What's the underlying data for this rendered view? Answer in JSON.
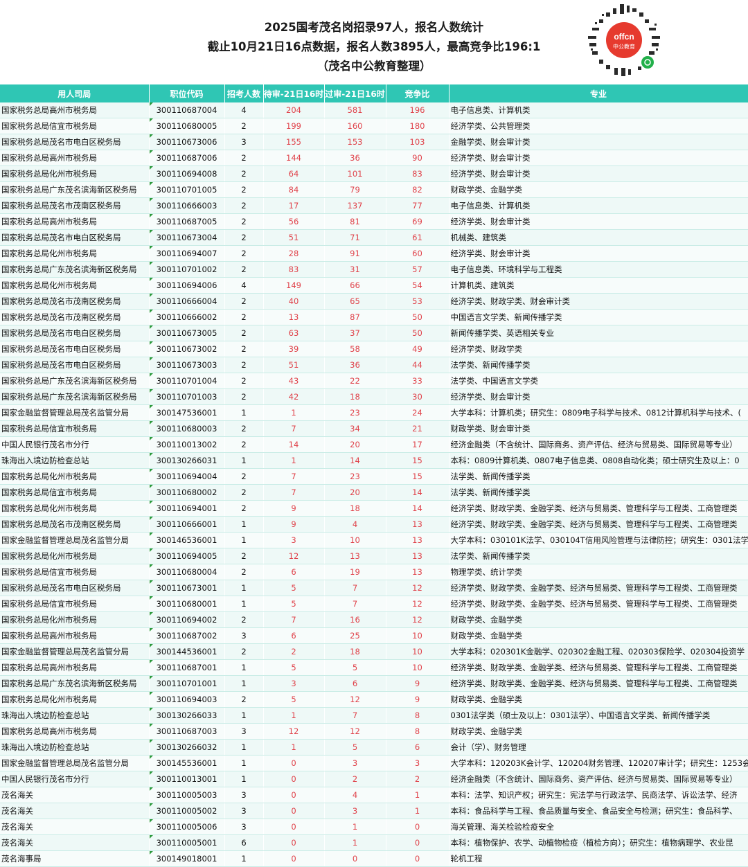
{
  "title": {
    "line1": "2025国考茂名岗招录97人，报名人数统计",
    "line2": "截止10月21日16点数据，报名人数3895人，最高竞争比196:1",
    "line3": "（茂名中公教育整理）"
  },
  "logo": {
    "text1": "offcn",
    "text2": "中公教育"
  },
  "columns": [
    "用人司局",
    "职位代码",
    "招考人数",
    "待审-21日16时",
    "过审-21日16时",
    "竞争比",
    "专业"
  ],
  "rows": [
    [
      "国家税务总局高州市税务局",
      "300110687004",
      "4",
      "204",
      "581",
      "196",
      "电子信息类、计算机类"
    ],
    [
      "国家税务总局信宜市税务局",
      "300110680005",
      "2",
      "199",
      "160",
      "180",
      "经济学类、公共管理类"
    ],
    [
      "国家税务总局茂名市电白区税务局",
      "300110673006",
      "3",
      "155",
      "153",
      "103",
      "金融学类、财会审计类"
    ],
    [
      "国家税务总局高州市税务局",
      "300110687006",
      "2",
      "144",
      "36",
      "90",
      "经济学类、财会审计类"
    ],
    [
      "国家税务总局化州市税务局",
      "300110694008",
      "2",
      "64",
      "101",
      "83",
      "经济学类、财会审计类"
    ],
    [
      "国家税务总局广东茂名滨海新区税务局",
      "300110701005",
      "2",
      "84",
      "79",
      "82",
      "财政学类、金融学类"
    ],
    [
      "国家税务总局茂名市茂南区税务局",
      "300110666003",
      "2",
      "17",
      "137",
      "77",
      "电子信息类、计算机类"
    ],
    [
      "国家税务总局高州市税务局",
      "300110687005",
      "2",
      "56",
      "81",
      "69",
      "经济学类、财会审计类"
    ],
    [
      "国家税务总局茂名市电白区税务局",
      "300110673004",
      "2",
      "51",
      "71",
      "61",
      "机械类、建筑类"
    ],
    [
      "国家税务总局化州市税务局",
      "300110694007",
      "2",
      "28",
      "91",
      "60",
      "经济学类、财会审计类"
    ],
    [
      "国家税务总局广东茂名滨海新区税务局",
      "300110701002",
      "2",
      "83",
      "31",
      "57",
      "电子信息类、环境科学与工程类"
    ],
    [
      "国家税务总局化州市税务局",
      "300110694006",
      "4",
      "149",
      "66",
      "54",
      "计算机类、建筑类"
    ],
    [
      "国家税务总局茂名市茂南区税务局",
      "300110666004",
      "2",
      "40",
      "65",
      "53",
      "经济学类、财政学类、财会审计类"
    ],
    [
      "国家税务总局茂名市茂南区税务局",
      "300110666002",
      "2",
      "13",
      "87",
      "50",
      "中国语言文学类、新闻传播学类"
    ],
    [
      "国家税务总局茂名市电白区税务局",
      "300110673005",
      "2",
      "63",
      "37",
      "50",
      "新闻传播学类、英语相关专业"
    ],
    [
      "国家税务总局茂名市电白区税务局",
      "300110673002",
      "2",
      "39",
      "58",
      "49",
      "经济学类、财政学类"
    ],
    [
      "国家税务总局茂名市电白区税务局",
      "300110673003",
      "2",
      "51",
      "36",
      "44",
      "法学类、新闻传播学类"
    ],
    [
      "国家税务总局广东茂名滨海新区税务局",
      "300110701004",
      "2",
      "43",
      "22",
      "33",
      "法学类、中国语言文学类"
    ],
    [
      "国家税务总局广东茂名滨海新区税务局",
      "300110701003",
      "2",
      "42",
      "18",
      "30",
      "经济学类、财会审计类"
    ],
    [
      "国家金融监督管理总局茂名监管分局",
      "300147536001",
      "1",
      "1",
      "23",
      "24",
      "大学本科：计算机类；研究生：0809电子科学与技术、0812计算机科学与技术、("
    ],
    [
      "国家税务总局信宜市税务局",
      "300110680003",
      "2",
      "7",
      "34",
      "21",
      "财政学类、财会审计类"
    ],
    [
      "中国人民银行茂名市分行",
      "300110013002",
      "2",
      "14",
      "20",
      "17",
      "经济金融类（不含统计、国际商务、资产评估、经济与贸易类、国际贸易等专业）"
    ],
    [
      "珠海出入境边防检查总站",
      "300130266031",
      "1",
      "1",
      "14",
      "15",
      "本科：0809计算机类、0807电子信息类、0808自动化类；硕士研究生及以上：0"
    ],
    [
      "国家税务总局化州市税务局",
      "300110694004",
      "2",
      "7",
      "23",
      "15",
      "法学类、新闻传播学类"
    ],
    [
      "国家税务总局信宜市税务局",
      "300110680002",
      "2",
      "7",
      "20",
      "14",
      "法学类、新闻传播学类"
    ],
    [
      "国家税务总局化州市税务局",
      "300110694001",
      "2",
      "9",
      "18",
      "14",
      "经济学类、财政学类、金融学类、经济与贸易类、管理科学与工程类、工商管理类"
    ],
    [
      "国家税务总局茂名市茂南区税务局",
      "300110666001",
      "1",
      "9",
      "4",
      "13",
      "经济学类、财政学类、金融学类、经济与贸易类、管理科学与工程类、工商管理类"
    ],
    [
      "国家金融监督管理总局茂名监管分局",
      "300146536001",
      "1",
      "3",
      "10",
      "13",
      "大学本科：030101K法学、030104T信用风险管理与法律防控；研究生：0301法学"
    ],
    [
      "国家税务总局化州市税务局",
      "300110694005",
      "2",
      "12",
      "13",
      "13",
      "法学类、新闻传播学类"
    ],
    [
      "国家税务总局信宜市税务局",
      "300110680004",
      "2",
      "6",
      "19",
      "13",
      "物理学类、统计学类"
    ],
    [
      "国家税务总局茂名市电白区税务局",
      "300110673001",
      "1",
      "5",
      "7",
      "12",
      "经济学类、财政学类、金融学类、经济与贸易类、管理科学与工程类、工商管理类"
    ],
    [
      "国家税务总局信宜市税务局",
      "300110680001",
      "1",
      "5",
      "7",
      "12",
      "经济学类、财政学类、金融学类、经济与贸易类、管理科学与工程类、工商管理类"
    ],
    [
      "国家税务总局化州市税务局",
      "300110694002",
      "2",
      "7",
      "16",
      "12",
      "财政学类、金融学类"
    ],
    [
      "国家税务总局高州市税务局",
      "300110687002",
      "3",
      "6",
      "25",
      "10",
      "财政学类、金融学类"
    ],
    [
      "国家金融监督管理总局茂名监管分局",
      "300144536001",
      "2",
      "2",
      "18",
      "10",
      "大学本科：020301K金融学、020302金融工程、020303保险学、020304投资学"
    ],
    [
      "国家税务总局高州市税务局",
      "300110687001",
      "1",
      "5",
      "5",
      "10",
      "经济学类、财政学类、金融学类、经济与贸易类、管理科学与工程类、工商管理类"
    ],
    [
      "国家税务总局广东茂名滨海新区税务局",
      "300110701001",
      "1",
      "3",
      "6",
      "9",
      "经济学类、财政学类、金融学类、经济与贸易类、管理科学与工程类、工商管理类"
    ],
    [
      "国家税务总局化州市税务局",
      "300110694003",
      "2",
      "5",
      "12",
      "9",
      "财政学类、金融学类"
    ],
    [
      "珠海出入境边防检查总站",
      "300130266033",
      "1",
      "1",
      "7",
      "8",
      "0301法学类（硕士及以上：0301法学）、中国语言文学类、新闻传播学类"
    ],
    [
      "国家税务总局高州市税务局",
      "300110687003",
      "3",
      "12",
      "12",
      "8",
      "财政学类、金融学类"
    ],
    [
      "珠海出入境边防检查总站",
      "300130266032",
      "1",
      "1",
      "5",
      "6",
      "会计（学）、财务管理"
    ],
    [
      "国家金融监督管理总局茂名监管分局",
      "300145536001",
      "1",
      "0",
      "3",
      "3",
      "大学本科：120203K会计学、120204财务管理、120207审计学；研究生：1253会"
    ],
    [
      "中国人民银行茂名市分行",
      "300110013001",
      "1",
      "0",
      "2",
      "2",
      "经济金融类（不含统计、国际商务、资产评估、经济与贸易类、国际贸易等专业）"
    ],
    [
      "茂名海关",
      "300110005003",
      "3",
      "0",
      "4",
      "1",
      "本科：法学、知识产权；研究生：宪法学与行政法学、民商法学、诉讼法学、经济"
    ],
    [
      "茂名海关",
      "300110005002",
      "3",
      "0",
      "3",
      "1",
      "本科：食品科学与工程、食品质量与安全、食品安全与检测；研究生：食品科学、"
    ],
    [
      "茂名海关",
      "300110005006",
      "3",
      "0",
      "1",
      "0",
      "海关管理、海关检验检疫安全"
    ],
    [
      "茂名海关",
      "300110005001",
      "6",
      "0",
      "1",
      "0",
      "本科：植物保护、农学、动植物检疫（植检方向）；研究生：植物病理学、农业昆"
    ],
    [
      "茂名海事局",
      "300149018001",
      "1",
      "0",
      "0",
      "0",
      "轮机工程"
    ]
  ]
}
